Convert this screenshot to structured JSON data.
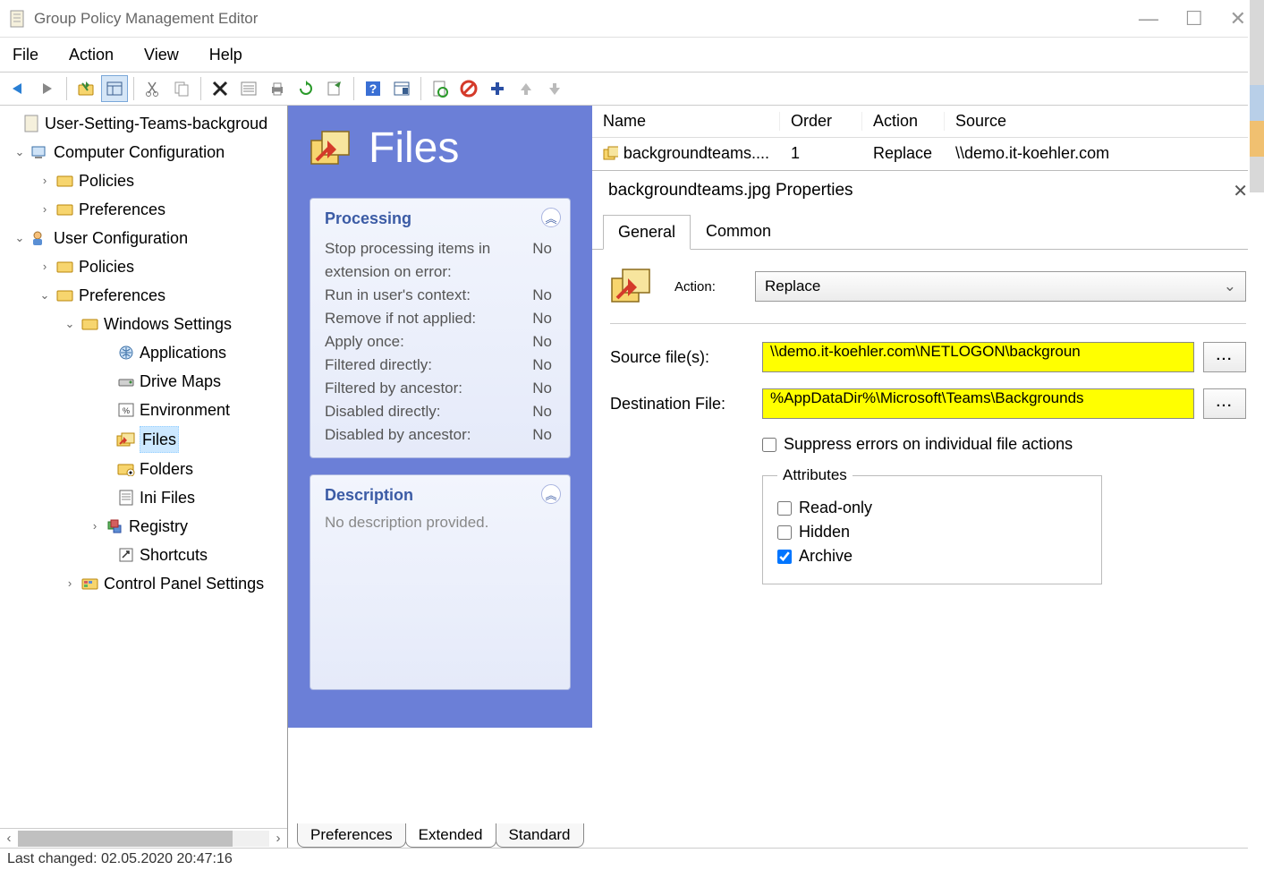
{
  "window": {
    "title": "Group Policy Management Editor",
    "minimize_glyph": "—",
    "maximize_glyph": "☐",
    "close_glyph": "✕"
  },
  "menu": {
    "items": [
      "File",
      "Action",
      "View",
      "Help"
    ]
  },
  "tree": {
    "root": "User-Setting-Teams-backgroud",
    "computer_config": "Computer Configuration",
    "cc_policies": "Policies",
    "cc_preferences": "Preferences",
    "user_config": "User Configuration",
    "uc_policies": "Policies",
    "uc_preferences": "Preferences",
    "windows_settings": "Windows Settings",
    "applications": "Applications",
    "drive_maps": "Drive Maps",
    "environment": "Environment",
    "files": "Files",
    "folders": "Folders",
    "ini_files": "Ini Files",
    "registry": "Registry",
    "shortcuts": "Shortcuts",
    "control_panel": "Control Panel Settings"
  },
  "panel": {
    "title": "Files",
    "processing": {
      "header": "Processing",
      "rows": [
        {
          "label": "Stop processing items in extension on error:",
          "value": "No"
        },
        {
          "label": "Run in user's context:",
          "value": "No"
        },
        {
          "label": "Remove if not applied:",
          "value": "No"
        },
        {
          "label": "Apply once:",
          "value": "No"
        },
        {
          "label": "Filtered directly:",
          "value": "No"
        },
        {
          "label": "Filtered by ancestor:",
          "value": "No"
        },
        {
          "label": "Disabled directly:",
          "value": "No"
        },
        {
          "label": "Disabled by ancestor:",
          "value": "No"
        }
      ]
    },
    "description": {
      "header": "Description",
      "text": "No description provided."
    }
  },
  "list": {
    "headers": {
      "name": "Name",
      "order": "Order",
      "action": "Action",
      "source": "Source"
    },
    "row": {
      "name": "backgroundteams....",
      "order": "1",
      "action": "Replace",
      "source": "\\\\demo.it-koehler.com"
    }
  },
  "dialog": {
    "title": "backgroundteams.jpg Properties",
    "tabs": {
      "general": "General",
      "common": "Common"
    },
    "action_label": "Action:",
    "action_value": "Replace",
    "source_label": "Source file(s):",
    "source_value": "\\\\demo.it-koehler.com\\NETLOGON\\backgroun",
    "dest_label": "Destination File:",
    "dest_value": "%AppDataDir%\\Microsoft\\Teams\\Backgrounds",
    "browse": "...",
    "suppress": "Suppress errors on individual file actions",
    "attributes_legend": "Attributes",
    "readonly": "Read-only",
    "hidden": "Hidden",
    "archive": "Archive"
  },
  "bottom_tabs": {
    "preferences": "Preferences",
    "extended": "Extended",
    "standard": "Standard"
  },
  "statusbar": "Last changed: 02.05.2020 20:47:16"
}
